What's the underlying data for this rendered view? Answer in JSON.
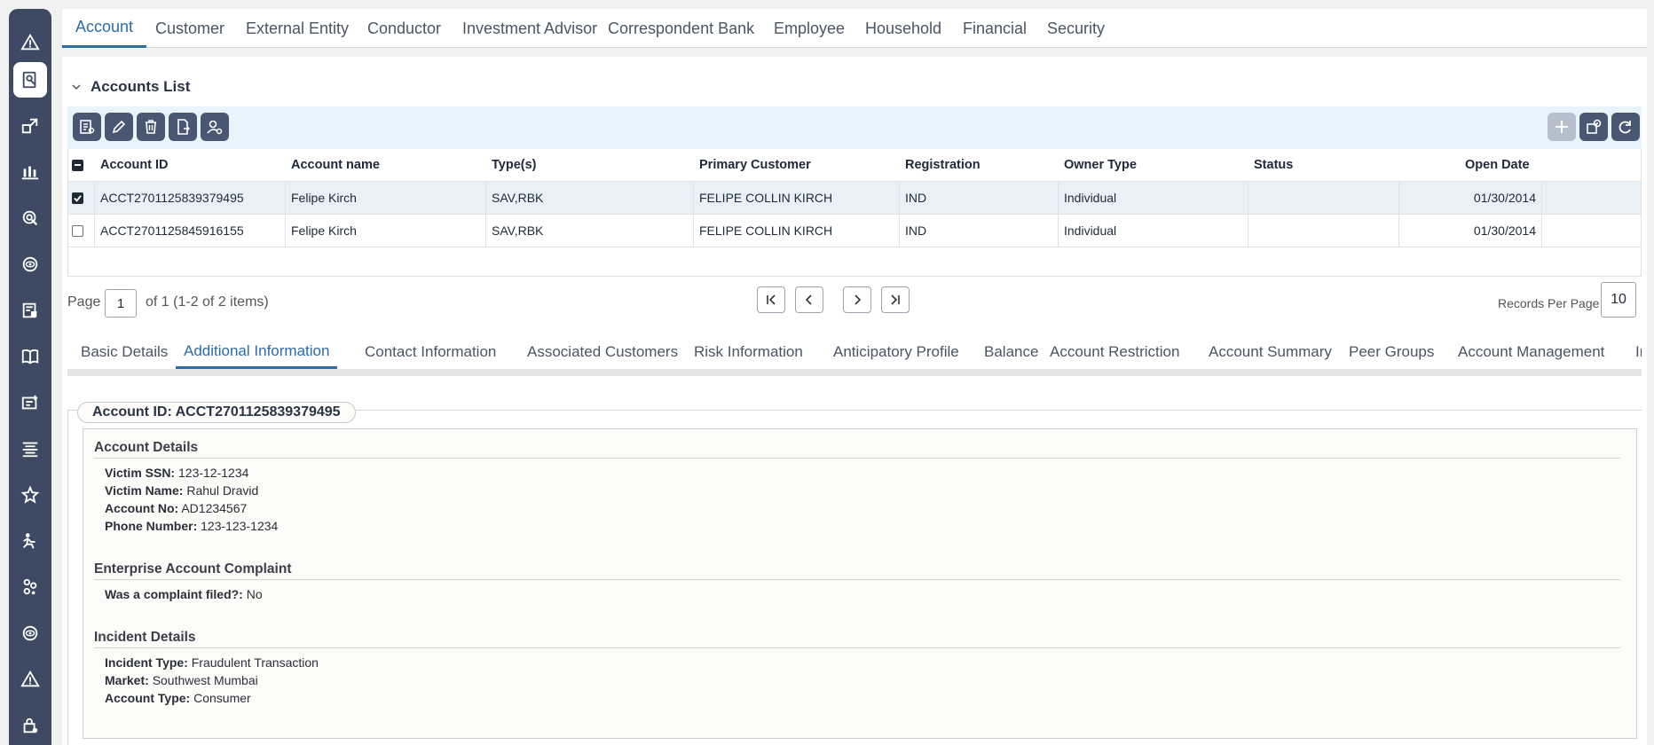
{
  "top_tabs": [
    "Account",
    "Customer",
    "External Entity",
    "Conductor",
    "Investment Advisor",
    "Correspondent Bank",
    "Employee",
    "Household",
    "Financial",
    "Security"
  ],
  "section_title": "Accounts List",
  "grid": {
    "columns": [
      "Account ID",
      "Account name",
      "Type(s)",
      "Primary Customer",
      "Registration",
      "Owner Type",
      "Status",
      "Open Date"
    ],
    "rows": [
      {
        "account_id": "ACCT2701125839379495",
        "account_name": "Felipe Kirch",
        "types": "SAV,RBK",
        "primary_customer": "FELIPE COLLIN KIRCH",
        "registration": "IND",
        "owner_type": "Individual",
        "status": "",
        "open_date": "01/30/2014",
        "checked": true
      },
      {
        "account_id": "ACCT2701125845916155",
        "account_name": "Felipe Kirch",
        "types": "SAV,RBK",
        "primary_customer": "FELIPE COLLIN KIRCH",
        "registration": "IND",
        "owner_type": "Individual",
        "status": "",
        "open_date": "01/30/2014",
        "checked": false
      }
    ]
  },
  "pagination": {
    "page_label": "Page",
    "page_value": "1",
    "of_text": "of 1 (1-2 of 2 items)",
    "records_label": "Records Per Page",
    "records_value": "10"
  },
  "sub_tabs": [
    "Basic Details",
    "Additional Information",
    "Contact Information",
    "Associated Customers",
    "Risk Information",
    "Anticipatory Profile",
    "Balance",
    "Account Restriction",
    "Account Summary",
    "Peer Groups",
    "Account Management",
    "Inv"
  ],
  "detail": {
    "account_pill": "Account ID: ACCT2701125839379495",
    "groups": [
      {
        "title": "Account Details",
        "fields": [
          {
            "label": "Victim SSN:",
            "value": "123-12-1234"
          },
          {
            "label": "Victim Name:",
            "value": "Rahul Dravid"
          },
          {
            "label": "Account No:",
            "value": "AD1234567"
          },
          {
            "label": "Phone Number:",
            "value": "123-123-1234"
          }
        ]
      },
      {
        "title": "Enterprise Account Complaint",
        "fields": [
          {
            "label": "Was a complaint filed?:",
            "value": "No"
          }
        ]
      },
      {
        "title": "Incident Details",
        "fields": [
          {
            "label": "Incident Type:",
            "value": "Fraudulent Transaction"
          },
          {
            "label": "Market:",
            "value": "Southwest Mumbai"
          },
          {
            "label": "Account Type:",
            "value": "Consumer"
          }
        ]
      }
    ]
  },
  "colors": {
    "accent": "#2b6bab",
    "rail": "#3e4a63",
    "toolbar_bg": "#e7f4fc",
    "selected_row": "#e8f1f7",
    "button": "#4a5773"
  },
  "rail_icons": [
    "alert-icon",
    "search-profile-icon",
    "link-icon",
    "chart-icon",
    "target-icon",
    "eye-cycle-icon",
    "report-icon",
    "book-icon",
    "message-icon",
    "list-icon",
    "star-icon",
    "person-run-icon",
    "people-icon",
    "eye-cycle-icon",
    "alert-icon",
    "lock-icon"
  ],
  "toolbar_icons": [
    "view-details-icon",
    "edit-icon",
    "delete-icon",
    "export-icon",
    "assign-icon",
    "add-icon",
    "settings-icon",
    "refresh-icon"
  ]
}
